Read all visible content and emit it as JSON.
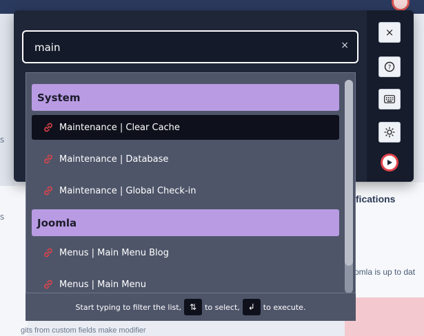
{
  "background": {
    "right_title": "ifications",
    "right_text": "omla is up to dat",
    "bottom_text": "gits from custom fields make modifier",
    "left_x": "s",
    "left_s": "s"
  },
  "search": {
    "value": "main",
    "clear_glyph": "×"
  },
  "side_buttons": {
    "close": "×",
    "help": "?",
    "keyboard": "keyboard-icon",
    "theme": "sun-icon",
    "play": "play-icon"
  },
  "groups": [
    {
      "title": "System",
      "items": [
        {
          "label": "Maintenance | Clear Cache",
          "active": true
        },
        {
          "label": "Maintenance | Database",
          "active": false
        },
        {
          "label": "Maintenance | Global Check-in",
          "active": false
        }
      ]
    },
    {
      "title": "Joomla",
      "items": [
        {
          "label": "Menus | Main Menu Blog",
          "active": false
        },
        {
          "label": "Menus | Main Menu",
          "active": false
        }
      ]
    }
  ],
  "hint": {
    "prefix": "Start typing to filter the list,",
    "select_key": "⇅",
    "middle": "to select,",
    "execute_key": "↲",
    "suffix": "to execute."
  },
  "colors": {
    "modal_bg": "#1f2638",
    "group_header": "#b99be3",
    "list_bg": "#4e5569",
    "active_item": "#0e111b",
    "link_icon": "#e0434b"
  }
}
